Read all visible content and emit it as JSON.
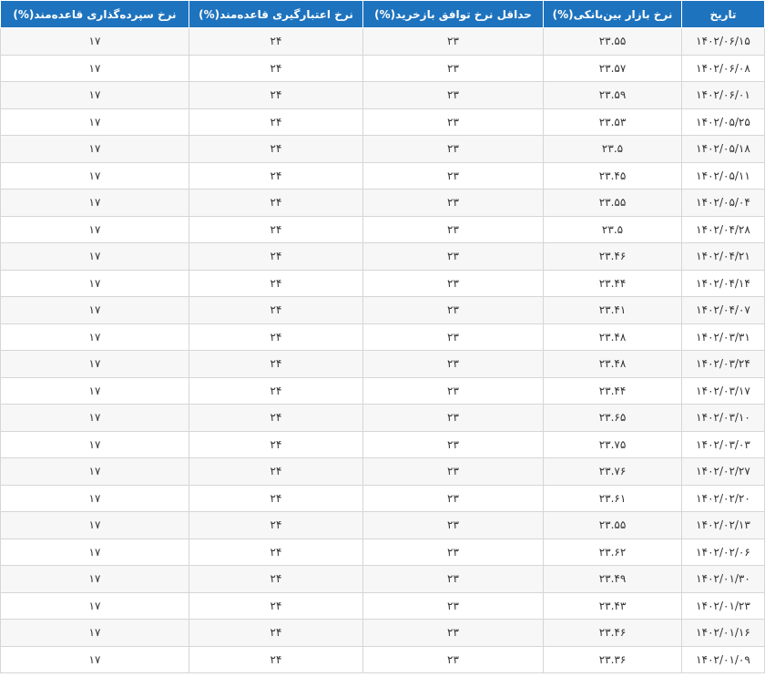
{
  "table": {
    "headers": {
      "date": "تاریخ",
      "interbank": "نرخ بازار بین‌بانکی(%)",
      "repo": "حداقل نرخ توافق بازخرید(%)",
      "lending": "نرخ اعتبارگیری قاعده‌مند(%)",
      "deposit": "نرخ سپرده‌گذاری قاعده‌مند(%)"
    },
    "rows": [
      {
        "date": "۱۴۰۲/۰۶/۱۵",
        "interbank": "۲۳.۵۵",
        "repo": "۲۳",
        "lending": "۲۴",
        "deposit": "۱۷"
      },
      {
        "date": "۱۴۰۲/۰۶/۰۸",
        "interbank": "۲۳.۵۷",
        "repo": "۲۳",
        "lending": "۲۴",
        "deposit": "۱۷"
      },
      {
        "date": "۱۴۰۲/۰۶/۰۱",
        "interbank": "۲۳.۵۹",
        "repo": "۲۳",
        "lending": "۲۴",
        "deposit": "۱۷"
      },
      {
        "date": "۱۴۰۲/۰۵/۲۵",
        "interbank": "۲۳.۵۳",
        "repo": "۲۳",
        "lending": "۲۴",
        "deposit": "۱۷"
      },
      {
        "date": "۱۴۰۲/۰۵/۱۸",
        "interbank": "۲۳.۵",
        "repo": "۲۳",
        "lending": "۲۴",
        "deposit": "۱۷"
      },
      {
        "date": "۱۴۰۲/۰۵/۱۱",
        "interbank": "۲۳.۴۵",
        "repo": "۲۳",
        "lending": "۲۴",
        "deposit": "۱۷"
      },
      {
        "date": "۱۴۰۲/۰۵/۰۴",
        "interbank": "۲۳.۵۵",
        "repo": "۲۳",
        "lending": "۲۴",
        "deposit": "۱۷"
      },
      {
        "date": "۱۴۰۲/۰۴/۲۸",
        "interbank": "۲۳.۵",
        "repo": "۲۳",
        "lending": "۲۴",
        "deposit": "۱۷"
      },
      {
        "date": "۱۴۰۲/۰۴/۲۱",
        "interbank": "۲۳.۴۶",
        "repo": "۲۳",
        "lending": "۲۴",
        "deposit": "۱۷"
      },
      {
        "date": "۱۴۰۲/۰۴/۱۴",
        "interbank": "۲۳.۴۴",
        "repo": "۲۳",
        "lending": "۲۴",
        "deposit": "۱۷"
      },
      {
        "date": "۱۴۰۲/۰۴/۰۷",
        "interbank": "۲۳.۴۱",
        "repo": "۲۳",
        "lending": "۲۴",
        "deposit": "۱۷"
      },
      {
        "date": "۱۴۰۲/۰۳/۳۱",
        "interbank": "۲۳.۴۸",
        "repo": "۲۳",
        "lending": "۲۴",
        "deposit": "۱۷"
      },
      {
        "date": "۱۴۰۲/۰۳/۲۴",
        "interbank": "۲۳.۴۸",
        "repo": "۲۳",
        "lending": "۲۴",
        "deposit": "۱۷"
      },
      {
        "date": "۱۴۰۲/۰۳/۱۷",
        "interbank": "۲۳.۴۴",
        "repo": "۲۳",
        "lending": "۲۴",
        "deposit": "۱۷"
      },
      {
        "date": "۱۴۰۲/۰۳/۱۰",
        "interbank": "۲۳.۶۵",
        "repo": "۲۳",
        "lending": "۲۴",
        "deposit": "۱۷"
      },
      {
        "date": "۱۴۰۲/۰۳/۰۳",
        "interbank": "۲۳.۷۵",
        "repo": "۲۳",
        "lending": "۲۴",
        "deposit": "۱۷"
      },
      {
        "date": "۱۴۰۲/۰۲/۲۷",
        "interbank": "۲۳.۷۶",
        "repo": "۲۳",
        "lending": "۲۴",
        "deposit": "۱۷"
      },
      {
        "date": "۱۴۰۲/۰۲/۲۰",
        "interbank": "۲۳.۶۱",
        "repo": "۲۳",
        "lending": "۲۴",
        "deposit": "۱۷"
      },
      {
        "date": "۱۴۰۲/۰۲/۱۳",
        "interbank": "۲۳.۵۵",
        "repo": "۲۳",
        "lending": "۲۴",
        "deposit": "۱۷"
      },
      {
        "date": "۱۴۰۲/۰۲/۰۶",
        "interbank": "۲۳.۶۲",
        "repo": "۲۳",
        "lending": "۲۴",
        "deposit": "۱۷"
      },
      {
        "date": "۱۴۰۲/۰۱/۳۰",
        "interbank": "۲۳.۴۹",
        "repo": "۲۳",
        "lending": "۲۴",
        "deposit": "۱۷"
      },
      {
        "date": "۱۴۰۲/۰۱/۲۳",
        "interbank": "۲۳.۴۳",
        "repo": "۲۳",
        "lending": "۲۴",
        "deposit": "۱۷"
      },
      {
        "date": "۱۴۰۲/۰۱/۱۶",
        "interbank": "۲۳.۴۶",
        "repo": "۲۳",
        "lending": "۲۴",
        "deposit": "۱۷"
      },
      {
        "date": "۱۴۰۲/۰۱/۰۹",
        "interbank": "۲۳.۳۶",
        "repo": "۲۳",
        "lending": "۲۴",
        "deposit": "۱۷"
      }
    ]
  },
  "colors": {
    "header_bg": "#1e73be",
    "header_text": "#ffffff",
    "row_alt_bg": "#f7f7f7",
    "border": "#d6d6d6"
  }
}
